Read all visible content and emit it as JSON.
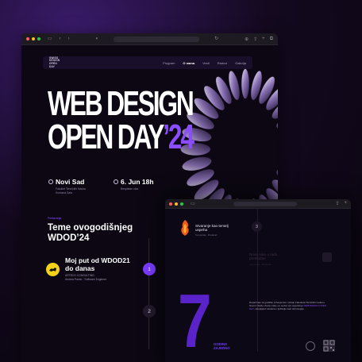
{
  "site": {
    "logo_lines": [
      "SWISS",
      "DESIGN",
      "OPEN",
      "DAY"
    ],
    "nav": [
      "Program",
      "O nama",
      "Vesti",
      "Radovi",
      "Galerija"
    ],
    "nav_active": "O nama"
  },
  "hero": {
    "title_line1": "WEB DESIGN",
    "title_line2_main": "OPEN DAY",
    "title_line2_accent": "’24"
  },
  "info": [
    {
      "main": "Novi Sad",
      "sub1": "Fakultet Tehničkih Nauka",
      "sub2": "Svečana Sala"
    },
    {
      "main": "6. Jun 18h",
      "sub1": "Besplatan ulaz",
      "sub2": ""
    }
  ],
  "section": {
    "eyebrow": "Predavanja",
    "title_line1": "Teme ovogodišnjeg",
    "title_line2": "WDOD’24"
  },
  "talk1": {
    "title_line1": "Moj put od WDOD21",
    "title_line2": "do danas",
    "company": "ARTECH CONSULTING",
    "speaker": "Andrea Pantić · Software Engineer",
    "number": "1"
  },
  "talk2": {
    "number": "2"
  },
  "front": {
    "talk_title_line1": "Stvaranje kao temelj",
    "talk_title_line2": "uspeha",
    "talk_meta": "Kompanija · Predavač",
    "number": "3",
    "next_title_line1": "Nova ruka u radu",
    "next_title_line2": "prethodne",
    "next_meta": "Kompanija · Predavač",
    "big_number": "7",
    "years_line1": "GODINA",
    "years_line2": "ZAJEDNO",
    "body_text": "Departman za grafičko inženjerstvo i dizajn Fakulteta Tehničkih nauka u Novom Sadu otvara vrata, po sedmi put organizuje ",
    "body_highlight": "WEB DESIGN OPEN DAY",
    "body_text_end": ", okupljajući studente i ljubitelje web tehnologija."
  },
  "colors": {
    "accent": "#8a4dff",
    "accent_dark": "#5a23c9",
    "badge_yellow": "#f5d21a",
    "page_bg": "#0c0712"
  }
}
